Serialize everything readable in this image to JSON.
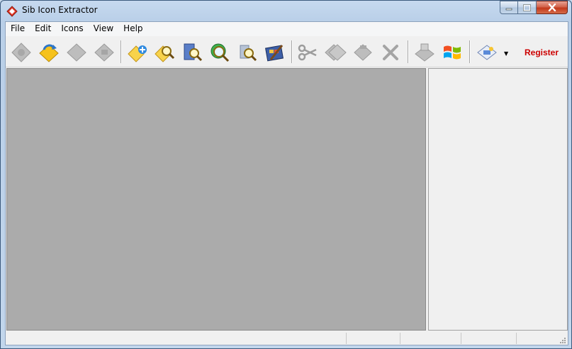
{
  "window": {
    "title": "Sib Icon Extractor",
    "controls": {
      "minimize": "minimize",
      "maximize": "maximize",
      "close": "close"
    }
  },
  "menu": [
    "File",
    "Edit",
    "Icons",
    "View",
    "Help"
  ],
  "toolbar": {
    "buttons": [
      {
        "name": "save-icon",
        "enabled": false
      },
      {
        "name": "save-as-icon",
        "enabled": true
      },
      {
        "name": "export-icon",
        "enabled": false
      },
      {
        "name": "extract-icon",
        "enabled": false
      },
      {
        "name": "add-folder-icon",
        "enabled": true
      },
      {
        "name": "search-folder-icon",
        "enabled": true
      },
      {
        "name": "search-file-icon",
        "enabled": true
      },
      {
        "name": "search-global-icon",
        "enabled": true
      },
      {
        "name": "search-resources-icon",
        "enabled": true
      },
      {
        "name": "film-tools-icon",
        "enabled": true
      },
      {
        "name": "cut-icon",
        "enabled": false
      },
      {
        "name": "copy-icon",
        "enabled": false
      },
      {
        "name": "paste-icon",
        "enabled": false
      },
      {
        "name": "delete-icon",
        "enabled": false
      },
      {
        "name": "print-icon",
        "enabled": false
      },
      {
        "name": "windows-logo-icon",
        "enabled": true
      },
      {
        "name": "view-options-icon",
        "enabled": true
      }
    ],
    "register_label": "Register"
  },
  "colors": {
    "accent_register": "#cc0000",
    "main_panel_bg": "#ababab"
  },
  "status": [
    "",
    "",
    "",
    ""
  ]
}
